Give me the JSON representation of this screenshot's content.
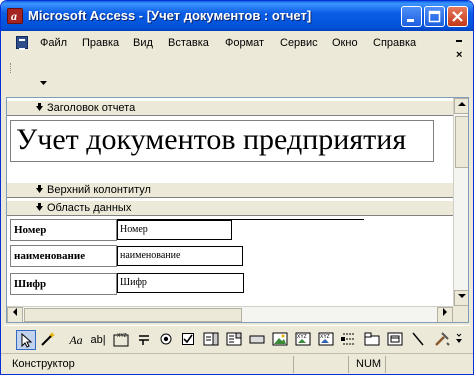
{
  "window": {
    "title": "Microsoft Access - [Учет документов : отчет]",
    "controls": {
      "minimize": "_",
      "maximize": "□",
      "close": "✕"
    }
  },
  "menu": {
    "items": [
      "Файл",
      "Правка",
      "Вид",
      "Вставка",
      "Формат",
      "Сервис",
      "Окно",
      "Справка"
    ],
    "mdi_minimize": "▁",
    "mdi_close": "×"
  },
  "report": {
    "sections": {
      "report_header": "Заголовок отчета",
      "page_header": "Верхний колонтитул",
      "detail": "Область данных"
    },
    "title_text": "Учет документов предприятия",
    "fields": [
      {
        "label": "Номер",
        "control": "Номер"
      },
      {
        "label": "наименование",
        "control": "наименование"
      },
      {
        "label": "Шифр",
        "control": "Шифр"
      }
    ]
  },
  "toolbox": {
    "tools": [
      "select-objects",
      "control-wizards",
      "label",
      "text-box",
      "option-group",
      "toggle-button",
      "option-button",
      "check-box",
      "combo-box",
      "list-box",
      "command-button",
      "image",
      "unbound-object-frame",
      "bound-object-frame",
      "page-break",
      "tab-control",
      "subform",
      "line",
      "rectangle",
      "more-controls"
    ]
  },
  "status": {
    "mode": "Конструктор",
    "num": "NUM"
  }
}
